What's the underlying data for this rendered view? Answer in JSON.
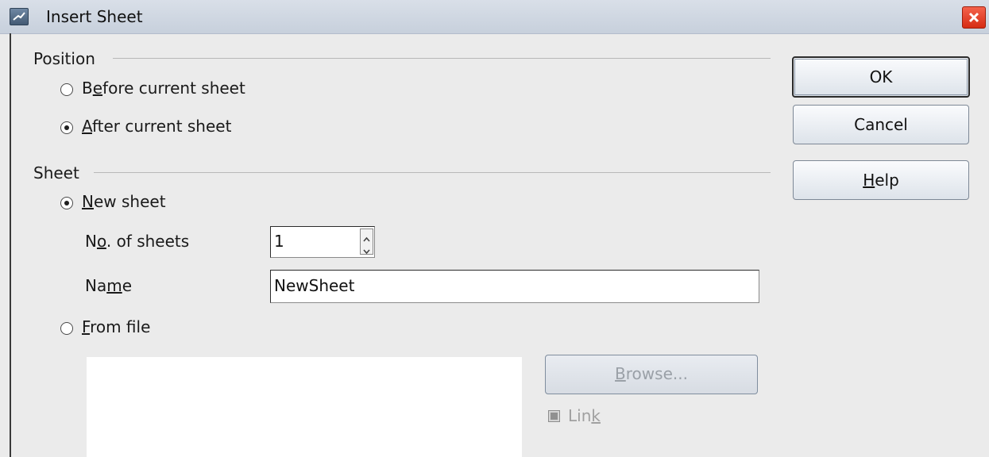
{
  "window": {
    "title": "Insert Sheet"
  },
  "position_group": {
    "label": "Position",
    "before": {
      "pre": "B",
      "ul": "e",
      "post": "fore current sheet",
      "selected": false
    },
    "after": {
      "pre": "",
      "ul": "A",
      "post": "fter current sheet",
      "selected": true
    }
  },
  "sheet_group": {
    "label": "Sheet",
    "new_sheet": {
      "pre": "",
      "ul": "N",
      "post": "ew sheet",
      "selected": true
    },
    "count_label": {
      "pre": "N",
      "ul": "o",
      "post": ". of sheets"
    },
    "count_value": "1",
    "name_label": {
      "pre": "Na",
      "ul": "m",
      "post": "e"
    },
    "name_value": "NewSheet",
    "from_file": {
      "pre": "",
      "ul": "F",
      "post": "rom file",
      "selected": false
    },
    "browse": {
      "pre": "",
      "ul": "B",
      "post": "rowse...",
      "enabled": false
    },
    "link": {
      "pre": "Lin",
      "ul": "k",
      "post": "",
      "enabled": false
    }
  },
  "buttons": {
    "ok": "OK",
    "cancel": "Cancel",
    "help": {
      "pre": "",
      "ul": "H",
      "post": "elp"
    }
  }
}
